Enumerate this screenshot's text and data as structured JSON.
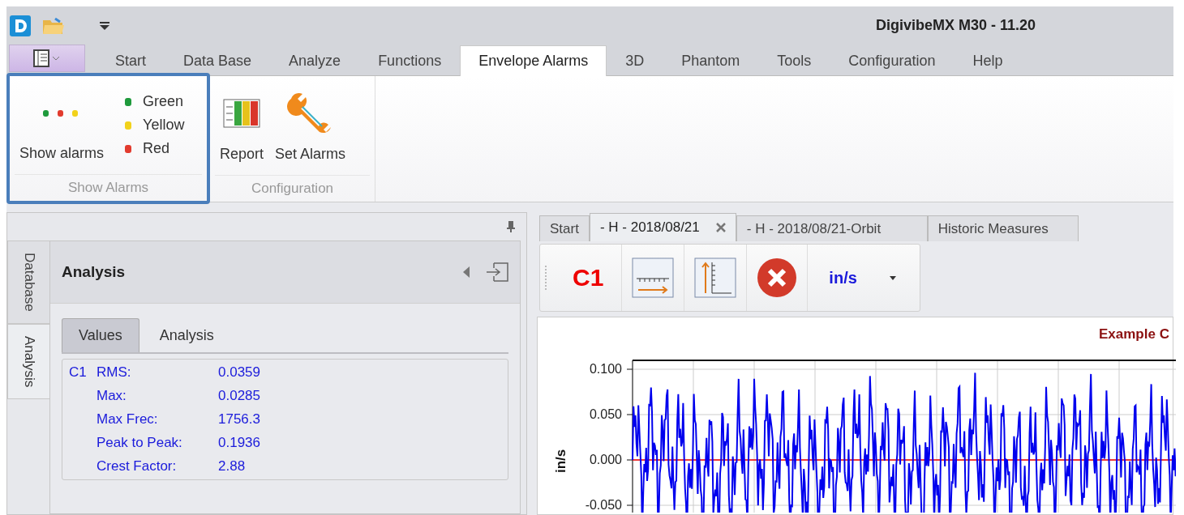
{
  "title_bar": {
    "title": "DigivibeMX M30 - 11.20"
  },
  "ribbon": {
    "tabs": [
      {
        "label": "Start",
        "selected": false
      },
      {
        "label": "Data Base",
        "selected": false
      },
      {
        "label": "Analyze",
        "selected": false
      },
      {
        "label": "Functions",
        "selected": false
      },
      {
        "label": "Envelope Alarms",
        "selected": true
      },
      {
        "label": "3D",
        "selected": false
      },
      {
        "label": "Phantom",
        "selected": false
      },
      {
        "label": "Tools",
        "selected": false
      },
      {
        "label": "Configuration",
        "selected": false
      },
      {
        "label": "Help",
        "selected": false
      }
    ],
    "groups": [
      {
        "caption": "Show Alarms",
        "highlighted": true,
        "large": [
          {
            "kind": "lights",
            "label": "Show alarms"
          }
        ],
        "colors": [
          {
            "label": "Green",
            "color": "#1f9a3c"
          },
          {
            "label": "Yellow",
            "color": "#f2d21b"
          },
          {
            "label": "Red",
            "color": "#e23b2e"
          }
        ]
      },
      {
        "caption": "Configuration",
        "highlighted": false,
        "large": [
          {
            "kind": "report",
            "label": "Report"
          },
          {
            "kind": "tool",
            "label": "Set Alarms"
          }
        ]
      }
    ]
  },
  "side_tabs": [
    {
      "label": "Database",
      "selected": false
    },
    {
      "label": "Analysis",
      "selected": true
    }
  ],
  "panel": {
    "title": "Analysis",
    "tabs": [
      {
        "label": "Values",
        "selected": true
      },
      {
        "label": "Analysis",
        "selected": false
      }
    ],
    "channel": "C1",
    "values": [
      {
        "label": "RMS:",
        "value": "0.0359"
      },
      {
        "label": "Max:",
        "value": "0.0285"
      },
      {
        "label": "Max Frec:",
        "value": "1756.3"
      },
      {
        "label": "Peak to Peak:",
        "value": "0.1936"
      },
      {
        "label": "Crest Factor:",
        "value": "2.88"
      }
    ]
  },
  "doc_tabs": [
    {
      "label": "Start",
      "selected": false,
      "closable": false
    },
    {
      "label": "- H - 2018/08/21",
      "selected": true,
      "closable": true
    },
    {
      "label": "- H - 2018/08/21-Orbit",
      "selected": false,
      "closable": false
    },
    {
      "label": "Historic Measures",
      "selected": false,
      "closable": false
    }
  ],
  "toolbar": {
    "channel": "C1",
    "unit": "in/s"
  },
  "chart": {
    "title": "Example C",
    "ylabel": "in/s",
    "y_tick_labels": [
      "0.100",
      "0.050",
      "0.000",
      "-0.050"
    ]
  }
}
